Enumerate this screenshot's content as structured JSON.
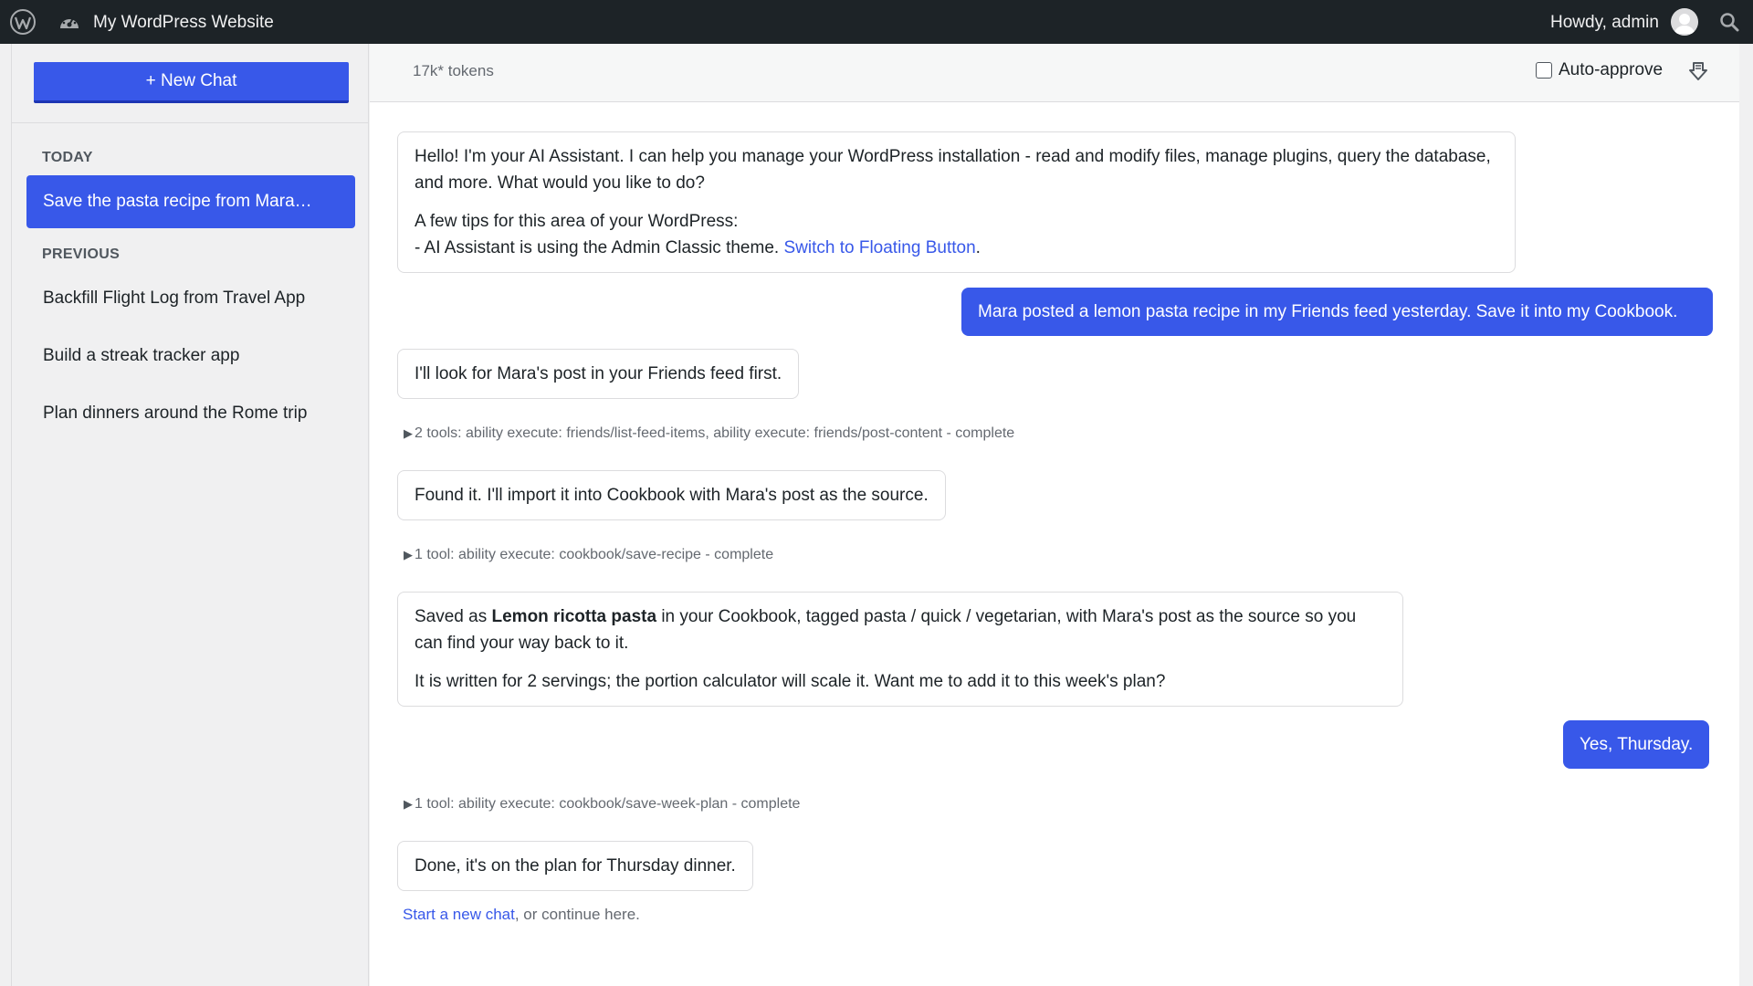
{
  "adminbar": {
    "site_name": "My WordPress Website",
    "howdy": "Howdy, admin",
    "icons": [
      "wordpress-logo-icon",
      "dashboard-icon",
      "avatar",
      "search-icon"
    ]
  },
  "sidebar": {
    "new_chat_label": "+ New Chat",
    "today_label": "TODAY",
    "previous_label": "PREVIOUS",
    "today_items": [
      {
        "label": "Save the pasta recipe from Mara's post"
      }
    ],
    "previous_items": [
      {
        "label": "Backfill Flight Log from Travel App"
      },
      {
        "label": "Build a streak tracker app"
      },
      {
        "label": "Plan dinners around the Rome trip"
      }
    ]
  },
  "topbar": {
    "tokens": "17k* tokens",
    "auto_approve_label": "Auto-approve",
    "auto_approve_checked": false
  },
  "messages": {
    "welcome_line1": "Hello! I'm your AI Assistant. I can help you manage your WordPress installation - read and modify files, manage plugins, query the database, and more. What would you like to do?",
    "welcome_tips_heading": "A few tips for this area of your WordPress:",
    "welcome_tip_prefix": "- AI Assistant is using the Admin Classic theme. ",
    "welcome_tip_link": "Switch to Floating Button",
    "welcome_tip_suffix": ".",
    "user_1": "Mara posted a lemon pasta recipe in my Friends feed yesterday. Save it into my Cookbook.",
    "assistant_1": "I'll look for Mara's post in your Friends feed first.",
    "tool_1": "2 tools: ability execute: friends/list-feed-items, ability execute: friends/post-content - complete",
    "assistant_2": "Found it. I'll import it into Cookbook with Mara's post as the source.",
    "tool_2": "1 tool: ability execute: cookbook/save-recipe - complete",
    "assistant_3_prefix": "Saved as ",
    "assistant_3_bold": "Lemon ricotta pasta",
    "assistant_3_suffix": " in your Cookbook, tagged pasta / quick / vegetarian, with Mara's post as the source so you can find your way back to it.",
    "assistant_3_line2": "It is written for 2 servings; the portion calculator will scale it. Want me to add it to this week's plan?",
    "user_2": "Yes, Thursday.",
    "tool_3": "1 tool: ability execute: cookbook/save-week-plan - complete",
    "assistant_4": "Done, it's on the plan for Thursday dinner.",
    "footer_link": "Start a new chat",
    "footer_suffix": ", or continue here."
  },
  "colors": {
    "accent": "#3858e9",
    "adminbar": "#1d2327",
    "muted_text": "#646970"
  }
}
